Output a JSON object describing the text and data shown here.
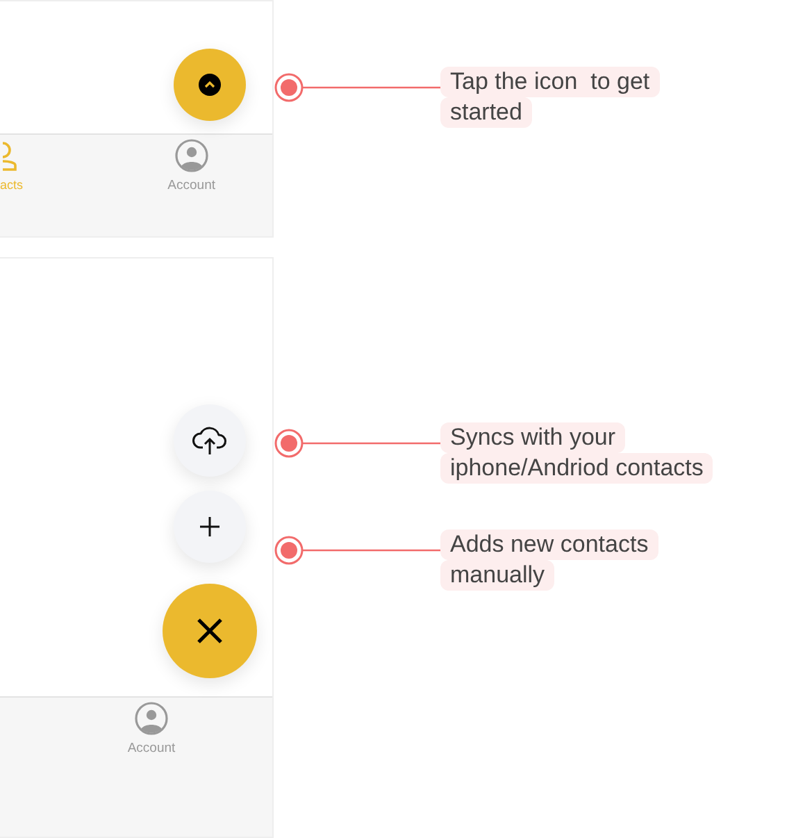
{
  "screens": [
    {
      "nav_tabs": [
        {
          "label": "acts",
          "kind": "contacts",
          "selected": true
        },
        {
          "label": "Account",
          "kind": "account",
          "selected": false
        }
      ],
      "fab_buttons": [
        {
          "kind": "expand"
        }
      ],
      "callouts": [
        {
          "lines": [
            "Tap the icon  to get",
            "started"
          ]
        }
      ]
    },
    {
      "nav_tabs": [
        {
          "label": "Account",
          "kind": "account",
          "selected": false
        }
      ],
      "fab_buttons": [
        {
          "kind": "sync"
        },
        {
          "kind": "add"
        },
        {
          "kind": "close"
        }
      ],
      "callouts": [
        {
          "lines": [
            "Syncs with your",
            "iphone/Andriod contacts"
          ]
        },
        {
          "lines": [
            "Adds new contacts",
            "manually"
          ]
        }
      ]
    }
  ]
}
